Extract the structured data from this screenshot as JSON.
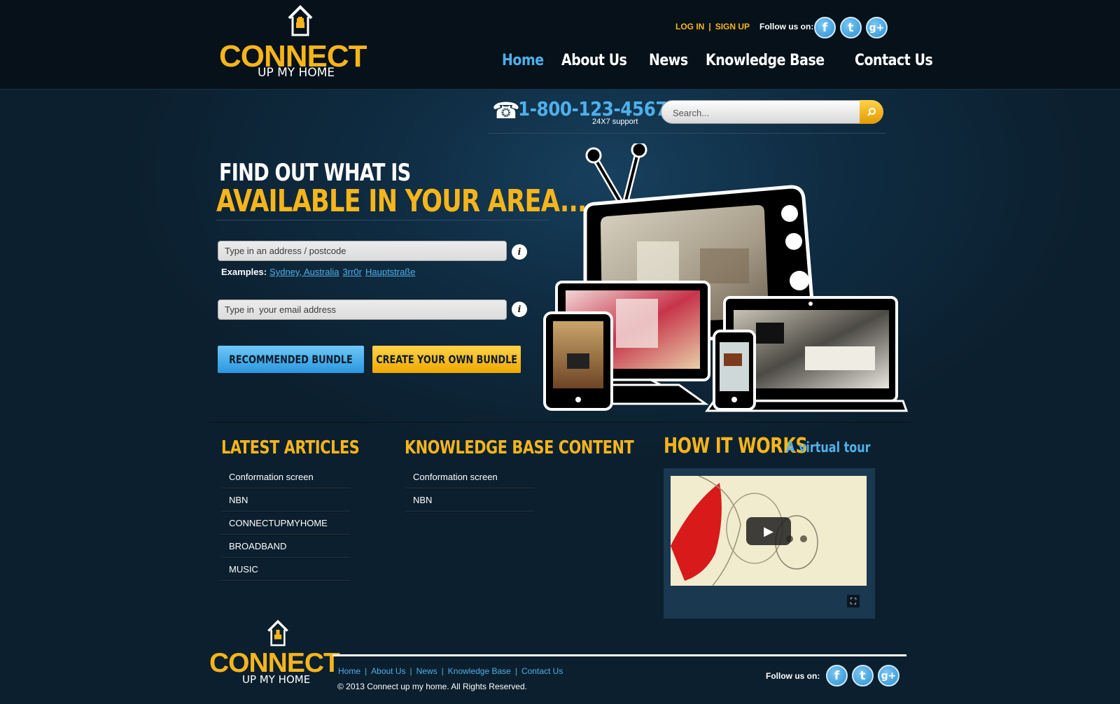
{
  "brand": {
    "word": "CONNECT",
    "sub": "UP MY HOME",
    "accent": "#f6b51b",
    "blue": "#4fb0ea"
  },
  "header": {
    "login": "LOG IN",
    "separator": "|",
    "signup": "SIGN UP",
    "follow": "Follow us on:",
    "social": [
      "facebook-icon",
      "twitter-icon",
      "google-plus-icon"
    ]
  },
  "nav": [
    "Home",
    "About Us",
    "News",
    "Knowledge Base",
    "Contact Us"
  ],
  "phone": {
    "number": "1-800-123-4567",
    "sub": "24X7 support"
  },
  "search": {
    "placeholder": "Search..."
  },
  "hero": {
    "line1": "FIND OUT WHAT IS",
    "line2": "AVAILABLE IN YOUR AREA...",
    "address_placeholder": "Type in an address / postcode",
    "email_placeholder": "Type in  your email address",
    "examples_label": "Examples:",
    "examples": [
      "Sydney, Australia",
      "3rr0r",
      "Hauptstraße"
    ],
    "btn_recommended": "RECOMMENDED BUNDLE",
    "btn_create": "CREATE YOUR OWN BUNDLE"
  },
  "articles": {
    "title": "LATEST ARTICLES",
    "items": [
      "Conformation screen",
      "NBN",
      "CONNECTUPMYHOME",
      "BROADBAND",
      "MUSIC"
    ]
  },
  "kb": {
    "title": "KNOWLEDGE BASE CONTENT",
    "items": [
      "Conformation screen",
      "NBN"
    ]
  },
  "how": {
    "title": "HOW IT WORKS",
    "sub": "A virtual tour"
  },
  "footer": {
    "nav": [
      "Home",
      "About Us",
      "News",
      "Knowledge Base",
      "Contact Us"
    ],
    "copyright": "© 2013 Connect up my home. All Rights Reserved.",
    "follow": "Follow us on:"
  }
}
